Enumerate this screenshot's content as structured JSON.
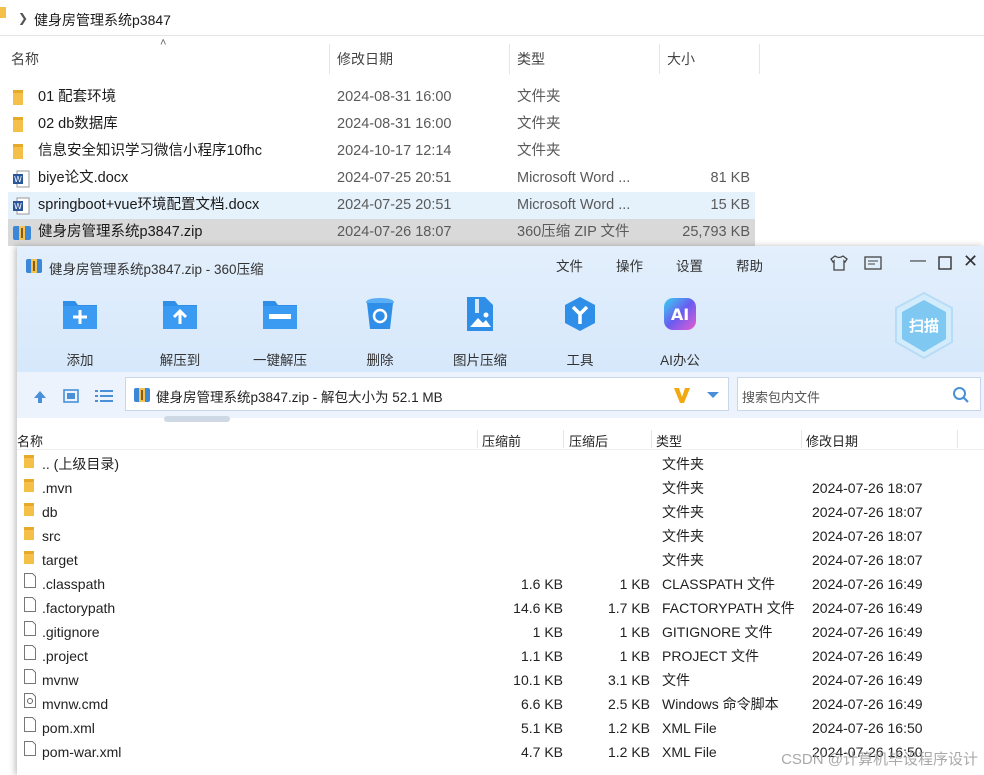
{
  "explorer": {
    "path": "健身房管理系统p3847",
    "headers": {
      "name": "名称",
      "date": "修改日期",
      "type": "类型",
      "size": "大小"
    },
    "rows": [
      {
        "icon": "folder-icon",
        "name": "01 配套环境",
        "date": "2024-08-31 16:00",
        "type": "文件夹",
        "size": ""
      },
      {
        "icon": "folder-icon",
        "name": "02 db数据库",
        "date": "2024-08-31 16:00",
        "type": "文件夹",
        "size": ""
      },
      {
        "icon": "folder-icon",
        "name": "信息安全知识学习微信小程序10fhc",
        "date": "2024-10-17 12:14",
        "type": "文件夹",
        "size": ""
      },
      {
        "icon": "word-doc-icon",
        "name": "biye论文.docx",
        "date": "2024-07-25 20:51",
        "type": "Microsoft Word ...",
        "size": "81 KB"
      },
      {
        "icon": "word-doc-icon",
        "name": "springboot+vue环境配置文档.docx",
        "date": "2024-07-25 20:51",
        "type": "Microsoft Word ...",
        "size": "15 KB"
      },
      {
        "icon": "zip-archive-icon",
        "name": "健身房管理系统p3847.zip",
        "date": "2024-07-26 18:07",
        "type": "360压缩 ZIP 文件",
        "size": "25,793 KB"
      }
    ]
  },
  "zip": {
    "title": "健身房管理系统p3847.zip - 360压缩",
    "menu": [
      "文件",
      "操作",
      "设置",
      "帮助"
    ],
    "tools": [
      {
        "label": "添加",
        "icon": "add-icon"
      },
      {
        "label": "解压到",
        "icon": "extract-to-icon"
      },
      {
        "label": "一键解压",
        "icon": "one-click-extract-icon"
      },
      {
        "label": "删除",
        "icon": "delete-icon"
      },
      {
        "label": "图片压缩",
        "icon": "image-compress-icon"
      },
      {
        "label": "工具",
        "icon": "tools-icon"
      },
      {
        "label": "AI办公",
        "icon": "ai-office-icon"
      }
    ],
    "ai_badge": "AI",
    "scan_label": "扫描",
    "address": "健身房管理系统p3847.zip - 解包大小为 52.1 MB",
    "search_placeholder": "搜索包内文件",
    "headers": {
      "name": "名称",
      "compressed_before": "压缩前",
      "compressed_after": "压缩后",
      "type": "类型",
      "date": "修改日期"
    },
    "rows": [
      {
        "kind": "folder",
        "name": ".. (上级目录)",
        "before": "",
        "after": "",
        "type": "文件夹",
        "date": ""
      },
      {
        "kind": "folder",
        "name": ".mvn",
        "before": "",
        "after": "",
        "type": "文件夹",
        "date": "2024-07-26 18:07"
      },
      {
        "kind": "folder",
        "name": "db",
        "before": "",
        "after": "",
        "type": "文件夹",
        "date": "2024-07-26 18:07"
      },
      {
        "kind": "folder",
        "name": "src",
        "before": "",
        "after": "",
        "type": "文件夹",
        "date": "2024-07-26 18:07"
      },
      {
        "kind": "folder",
        "name": "target",
        "before": "",
        "after": "",
        "type": "文件夹",
        "date": "2024-07-26 18:07"
      },
      {
        "kind": "file",
        "name": ".classpath",
        "before": "1.6 KB",
        "after": "1 KB",
        "type": "CLASSPATH 文件",
        "date": "2024-07-26 16:49"
      },
      {
        "kind": "file",
        "name": ".factorypath",
        "before": "14.6 KB",
        "after": "1.7 KB",
        "type": "FACTORYPATH 文件",
        "date": "2024-07-26 16:49"
      },
      {
        "kind": "file",
        "name": ".gitignore",
        "before": "1 KB",
        "after": "1 KB",
        "type": "GITIGNORE 文件",
        "date": "2024-07-26 16:49"
      },
      {
        "kind": "file",
        "name": ".project",
        "before": "1.1 KB",
        "after": "1 KB",
        "type": "PROJECT 文件",
        "date": "2024-07-26 16:49"
      },
      {
        "kind": "file",
        "name": "mvnw",
        "before": "10.1 KB",
        "after": "3.1 KB",
        "type": "文件",
        "date": "2024-07-26 16:49"
      },
      {
        "kind": "cmd",
        "name": "mvnw.cmd",
        "before": "6.6 KB",
        "after": "2.5 KB",
        "type": "Windows 命令脚本",
        "date": "2024-07-26 16:49"
      },
      {
        "kind": "file",
        "name": "pom.xml",
        "before": "5.1 KB",
        "after": "1.2 KB",
        "type": "XML File",
        "date": "2024-07-26 16:50"
      },
      {
        "kind": "file",
        "name": "pom-war.xml",
        "before": "4.7 KB",
        "after": "1.2 KB",
        "type": "XML File",
        "date": "2024-07-26 16:50"
      }
    ]
  },
  "watermark": "CSDN @计算机毕设程序设计",
  "colors": {
    "accent": "#2f8fe8",
    "folder": "#f5c04a",
    "selection": "#e5f1fb",
    "selection_gray": "#d9d9d9"
  }
}
